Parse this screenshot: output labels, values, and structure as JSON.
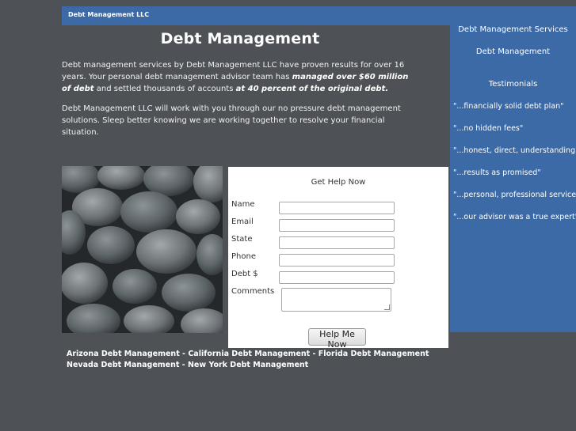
{
  "header": {
    "brand": "Debt Management LLC"
  },
  "main": {
    "title": "Debt Management",
    "para1": {
      "before": "Debt management services by Debt Management LLC have proven results for over 16 years. Your personal debt management advisor team has ",
      "emph1": "managed over $60 million of debt",
      "middle": " and settled thousands of accounts ",
      "emph2": "at 40 percent of the original debt.",
      "after": ""
    },
    "para2": "Debt Management LLC will work with you through our no pressure debt management solutions. Sleep better knowing we are working together to resolve your financial situation."
  },
  "form": {
    "title": "Get Help Now",
    "fields": {
      "name": "Name",
      "email": "Email",
      "state": "State",
      "phone": "Phone",
      "debt": "Debt $",
      "comments": "Comments"
    },
    "submit": "Help Me Now"
  },
  "sidebar": {
    "links": [
      "Debt Management Services",
      "Debt Management"
    ],
    "testimonials_heading": "Testimonials",
    "testimonials": [
      "\"...financially solid debt plan\"",
      "\"...no hidden fees\"",
      "\"...honest, direct, understanding\"",
      "\"...results as promised\"",
      "\"...personal, professional service\"",
      "\"...our advisor was a true expert\""
    ]
  },
  "footer": {
    "links": [
      "Arizona Debt Management",
      "California Debt Management",
      "Florida Debt Management",
      "Nevada Debt Management",
      "New York Debt Management"
    ],
    "separator": " - "
  },
  "colors": {
    "background": "#4e5156",
    "accent_blue": "#3b6aa7",
    "form_bg": "#ffffff"
  }
}
